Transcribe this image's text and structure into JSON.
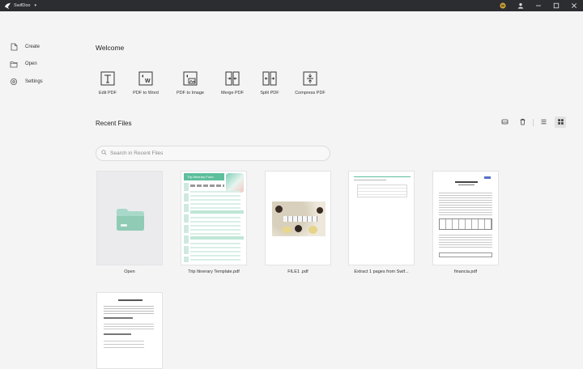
{
  "app": {
    "title": "SwifDoo",
    "caret": "▾"
  },
  "sidebar": {
    "items": [
      {
        "label": "Create",
        "icon": "create-file-icon"
      },
      {
        "label": "Open",
        "icon": "open-folder-icon"
      },
      {
        "label": "Settings",
        "icon": "gear-icon"
      }
    ]
  },
  "welcome": {
    "title": "Welcome",
    "tools": [
      {
        "label": "Edit PDF",
        "icon": "edit-pdf-icon"
      },
      {
        "label": "PDF to Word",
        "icon": "pdf-to-word-icon"
      },
      {
        "label": "PDF to Image",
        "icon": "pdf-to-image-icon"
      },
      {
        "label": "Merge PDF",
        "icon": "merge-pdf-icon"
      },
      {
        "label": "Split PDF",
        "icon": "split-pdf-icon"
      },
      {
        "label": "Compress PDF",
        "icon": "compress-pdf-icon"
      }
    ]
  },
  "recent": {
    "title": "Recent Files",
    "search_placeholder": "Search in Recent Files",
    "files": [
      {
        "name": "Open"
      },
      {
        "name": "Trip Itinerary Template.pdf",
        "thumb_heading": "Trip Itinerary Form"
      },
      {
        "name": "FILE1 .pdf"
      },
      {
        "name": "Extract 1 pages from Swif..."
      },
      {
        "name": "financia.pdf"
      },
      {
        "name": ""
      }
    ]
  },
  "colors": {
    "titlebar": "#2b2d31",
    "accent_green": "#5dbf9c",
    "folder": "#a8d8c8",
    "background": "#f4f4f5"
  }
}
